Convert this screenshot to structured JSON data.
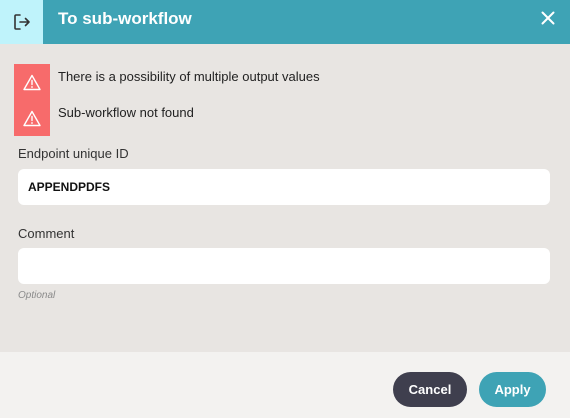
{
  "dialog": {
    "title": "To sub-workflow",
    "header_icon": "exit-arrow-icon",
    "close_icon": "close-icon"
  },
  "warnings": [
    {
      "icon": "warning-triangle-icon",
      "text": "There is a possibility of multiple output values"
    },
    {
      "icon": "warning-triangle-icon",
      "text": "Sub-workflow not found"
    }
  ],
  "fields": {
    "endpoint": {
      "label": "Endpoint unique ID",
      "value": "APPENDPDFS"
    },
    "comment": {
      "label": "Comment",
      "value": "",
      "hint": "Optional"
    }
  },
  "buttons": {
    "cancel": "Cancel",
    "apply": "Apply"
  },
  "colors": {
    "header": "#3ea3b5",
    "header_icon_bg": "#bff3fb",
    "warning": "#f76b6b",
    "cancel": "#3f3f4e",
    "apply": "#3ea3b5"
  }
}
